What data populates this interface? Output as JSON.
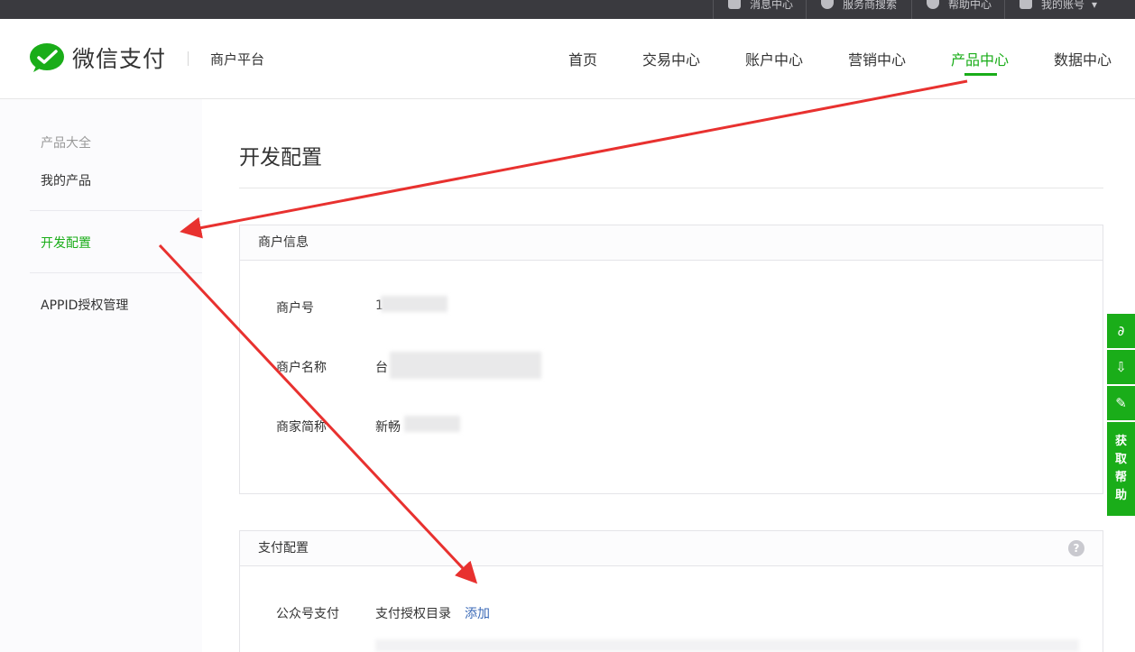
{
  "topbar": {
    "items": [
      {
        "label": "消息中心",
        "icon": "mail-icon"
      },
      {
        "label": "服务商搜索",
        "icon": "search-circle-icon"
      },
      {
        "label": "帮助中心",
        "icon": "help-circle-icon"
      },
      {
        "label": "我的账号",
        "icon": "user-icon"
      }
    ]
  },
  "header": {
    "logo_text": "微信支付",
    "platform": "商户平台",
    "nav": [
      "首页",
      "交易中心",
      "账户中心",
      "营销中心",
      "产品中心",
      "数据中心"
    ],
    "active_nav": "产品中心"
  },
  "sidebar": {
    "items": [
      {
        "label": "产品大全"
      },
      {
        "label": "我的产品"
      },
      {
        "label": "开发配置"
      },
      {
        "label": "APPID授权管理"
      }
    ]
  },
  "main": {
    "title": "开发配置",
    "merchant_panel": {
      "title": "商户信息",
      "rows": [
        {
          "label": "商户号",
          "value": "1"
        },
        {
          "label": "商户名称",
          "value": "台"
        },
        {
          "label": "商家简称",
          "value": "新畅"
        }
      ]
    },
    "pay_panel": {
      "title": "支付配置",
      "help": "?",
      "row_label": "公众号支付",
      "row_value": "支付授权目录",
      "add_link": "添加"
    }
  },
  "float_tools": {
    "help_chars": [
      "获",
      "取",
      "帮",
      "助"
    ]
  },
  "colors": {
    "accent": "#1aad19",
    "topbar": "#3a3a3f",
    "arrow": "#e8312f",
    "link": "#3b6ab7"
  }
}
